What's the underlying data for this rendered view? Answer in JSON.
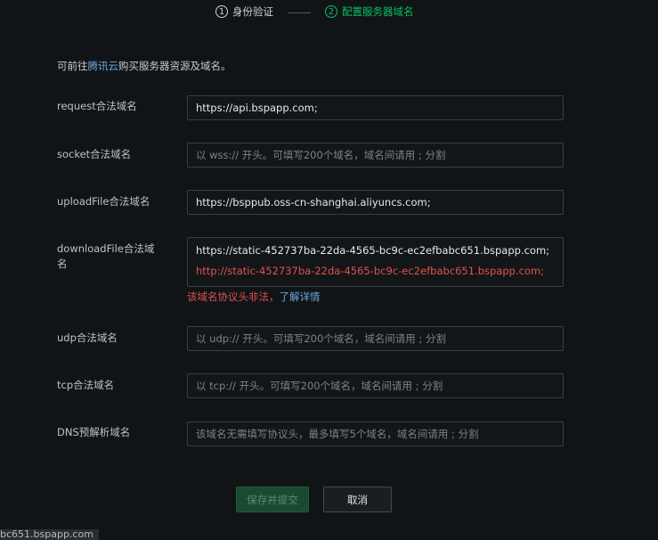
{
  "steps": [
    {
      "num": "1",
      "label": "身份验证"
    },
    {
      "num": "2",
      "label": "配置服务器域名"
    }
  ],
  "colors": {
    "accent": "#07c160",
    "error": "#e15050",
    "link": "#6fa8dc"
  },
  "intro": {
    "prefix": "可前往",
    "link": "腾讯云",
    "suffix": "购买服务器资源及域名。"
  },
  "fields": {
    "request": {
      "label": "request合法域名",
      "value": "https://api.bspapp.com;"
    },
    "socket": {
      "label": "socket合法域名",
      "placeholder": "以 wss:// 开头。可填写200个域名，域名间请用 ; 分割"
    },
    "uploadFile": {
      "label": "uploadFile合法域名",
      "value": "https://bsppub.oss-cn-shanghai.aliyuncs.com;"
    },
    "downloadFile": {
      "label": "downloadFile合法域名",
      "line1": "https://static-452737ba-22da-4565-bc9c-ec2efbabc651.bspapp.com;",
      "line2": "http://static-452737ba-22da-4565-bc9c-ec2efbabc651.bspapp.com;",
      "error": "该域名协议头非法，",
      "error_link": "了解详情"
    },
    "udp": {
      "label": "udp合法域名",
      "placeholder": "以 udp:// 开头。可填写200个域名，域名间请用 ; 分割"
    },
    "tcp": {
      "label": "tcp合法域名",
      "placeholder": "以 tcp:// 开头。可填写200个域名，域名间请用 ; 分割"
    },
    "dns": {
      "label": "DNS预解析域名",
      "placeholder": "该域名无需填写协议头，最多填写5个域名，域名间请用 ; 分割"
    }
  },
  "buttons": {
    "save": "保存并提交",
    "cancel": "取消"
  },
  "status_bar": "bc651.bspapp.com"
}
